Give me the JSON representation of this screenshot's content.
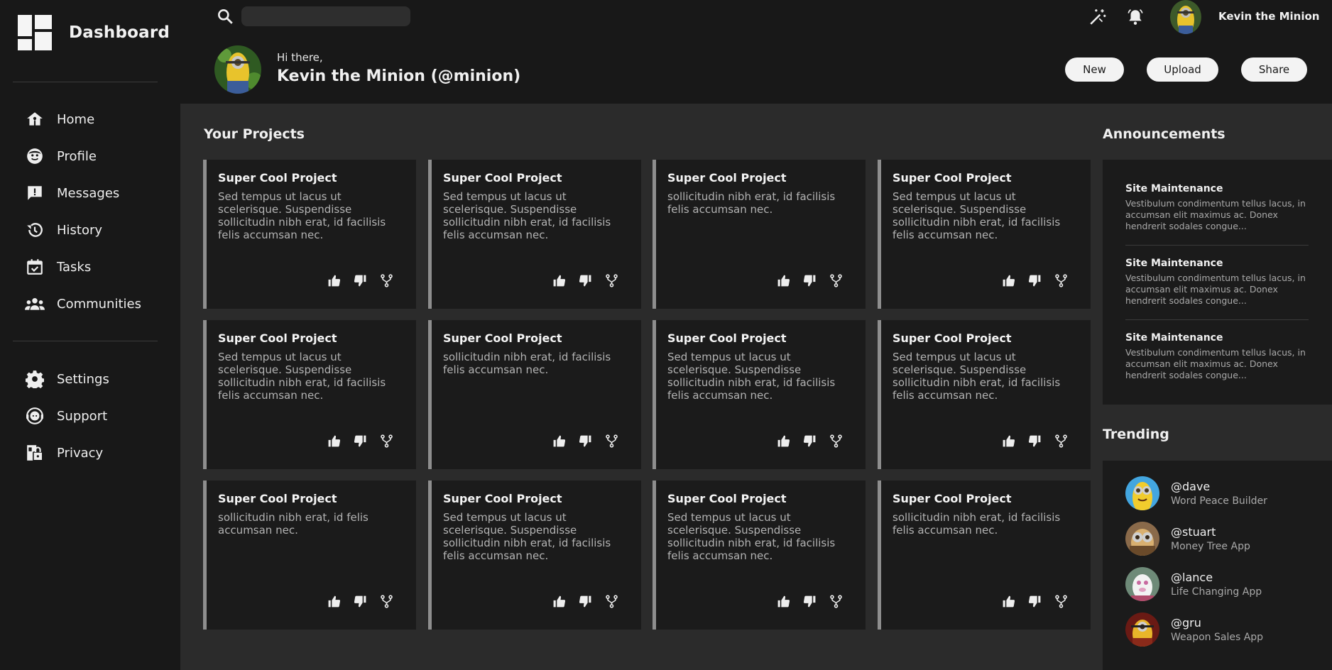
{
  "sidebar": {
    "title": "Dashboard",
    "items": [
      {
        "label": "Home",
        "icon": "home-icon"
      },
      {
        "label": "Profile",
        "icon": "profile-icon"
      },
      {
        "label": "Messages",
        "icon": "messages-icon"
      },
      {
        "label": "History",
        "icon": "history-icon"
      },
      {
        "label": "Tasks",
        "icon": "tasks-icon"
      },
      {
        "label": "Communities",
        "icon": "communities-icon"
      },
      {
        "label": "Settings",
        "icon": "settings-icon"
      },
      {
        "label": "Support",
        "icon": "support-icon"
      },
      {
        "label": "Privacy",
        "icon": "privacy-icon"
      }
    ]
  },
  "header": {
    "search_placeholder": "",
    "username": "Kevin the Minion",
    "greeting": "Hi there,",
    "display_name": "Kevin the Minion (@minion)",
    "buttons": {
      "new": "New",
      "upload": "Upload",
      "share": "Share"
    }
  },
  "projects": {
    "title": "Your Projects",
    "cards": [
      {
        "title": "Super Cool Project",
        "desc": "Sed tempus ut lacus ut scelerisque. Suspendisse sollicitudin nibh erat, id facilisis felis accumsan nec."
      },
      {
        "title": "Super Cool Project",
        "desc": "Sed tempus ut lacus ut scelerisque. Suspendisse sollicitudin nibh erat, id facilisis felis accumsan nec."
      },
      {
        "title": "Super Cool Project",
        "desc": "sollicitudin nibh erat, id facilisis felis accumsan nec."
      },
      {
        "title": "Super Cool Project",
        "desc": "Sed tempus ut lacus ut scelerisque. Suspendisse sollicitudin nibh erat, id facilisis felis accumsan nec."
      },
      {
        "title": "Super Cool Project",
        "desc": "Sed tempus ut lacus ut scelerisque. Suspendisse sollicitudin nibh erat, id facilisis felis accumsan nec."
      },
      {
        "title": "Super Cool Project",
        "desc": "sollicitudin nibh erat, id facilisis felis accumsan nec."
      },
      {
        "title": "Super Cool Project",
        "desc": "Sed tempus ut lacus ut scelerisque. Suspendisse sollicitudin nibh erat, id facilisis felis accumsan nec."
      },
      {
        "title": "Super Cool Project",
        "desc": "Sed tempus ut lacus ut scelerisque. Suspendisse sollicitudin nibh erat, id facilisis felis accumsan nec."
      },
      {
        "title": "Super Cool Project",
        "desc": "sollicitudin nibh erat, id felis accumsan nec."
      },
      {
        "title": "Super Cool Project",
        "desc": "Sed tempus ut lacus ut scelerisque. Suspendisse sollicitudin nibh erat, id facilisis felis accumsan nec."
      },
      {
        "title": "Super Cool Project",
        "desc": "Sed tempus ut lacus ut scelerisque. Suspendisse sollicitudin nibh erat, id facilisis felis accumsan nec."
      },
      {
        "title": "Super Cool Project",
        "desc": "sollicitudin nibh erat, id facilisis felis accumsan nec."
      }
    ]
  },
  "announcements": {
    "title": "Announcements",
    "items": [
      {
        "title": "Site Maintenance",
        "body": "Vestibulum condimentum tellus lacus, in accumsan elit maximus ac. Donex hendrerit sodales congue..."
      },
      {
        "title": "Site Maintenance",
        "body": "Vestibulum condimentum tellus lacus, in accumsan elit maximus ac. Donex hendrerit sodales congue..."
      },
      {
        "title": "Site Maintenance",
        "body": "Vestibulum condimentum tellus lacus, in accumsan elit maximus ac. Donex hendrerit sodales congue..."
      }
    ]
  },
  "trending": {
    "title": "Trending",
    "items": [
      {
        "handle": "@dave",
        "project": "Word Peace Builder"
      },
      {
        "handle": "@stuart",
        "project": "Money Tree App"
      },
      {
        "handle": "@lance",
        "project": "Life Changing App"
      },
      {
        "handle": "@gru",
        "project": "Weapon Sales App"
      }
    ]
  },
  "colors": {
    "sidebar_bg": "#181818",
    "main_bg": "#2b2b2b",
    "card_bg": "#1b1b1b",
    "card_accent": "#8e8e8e"
  }
}
